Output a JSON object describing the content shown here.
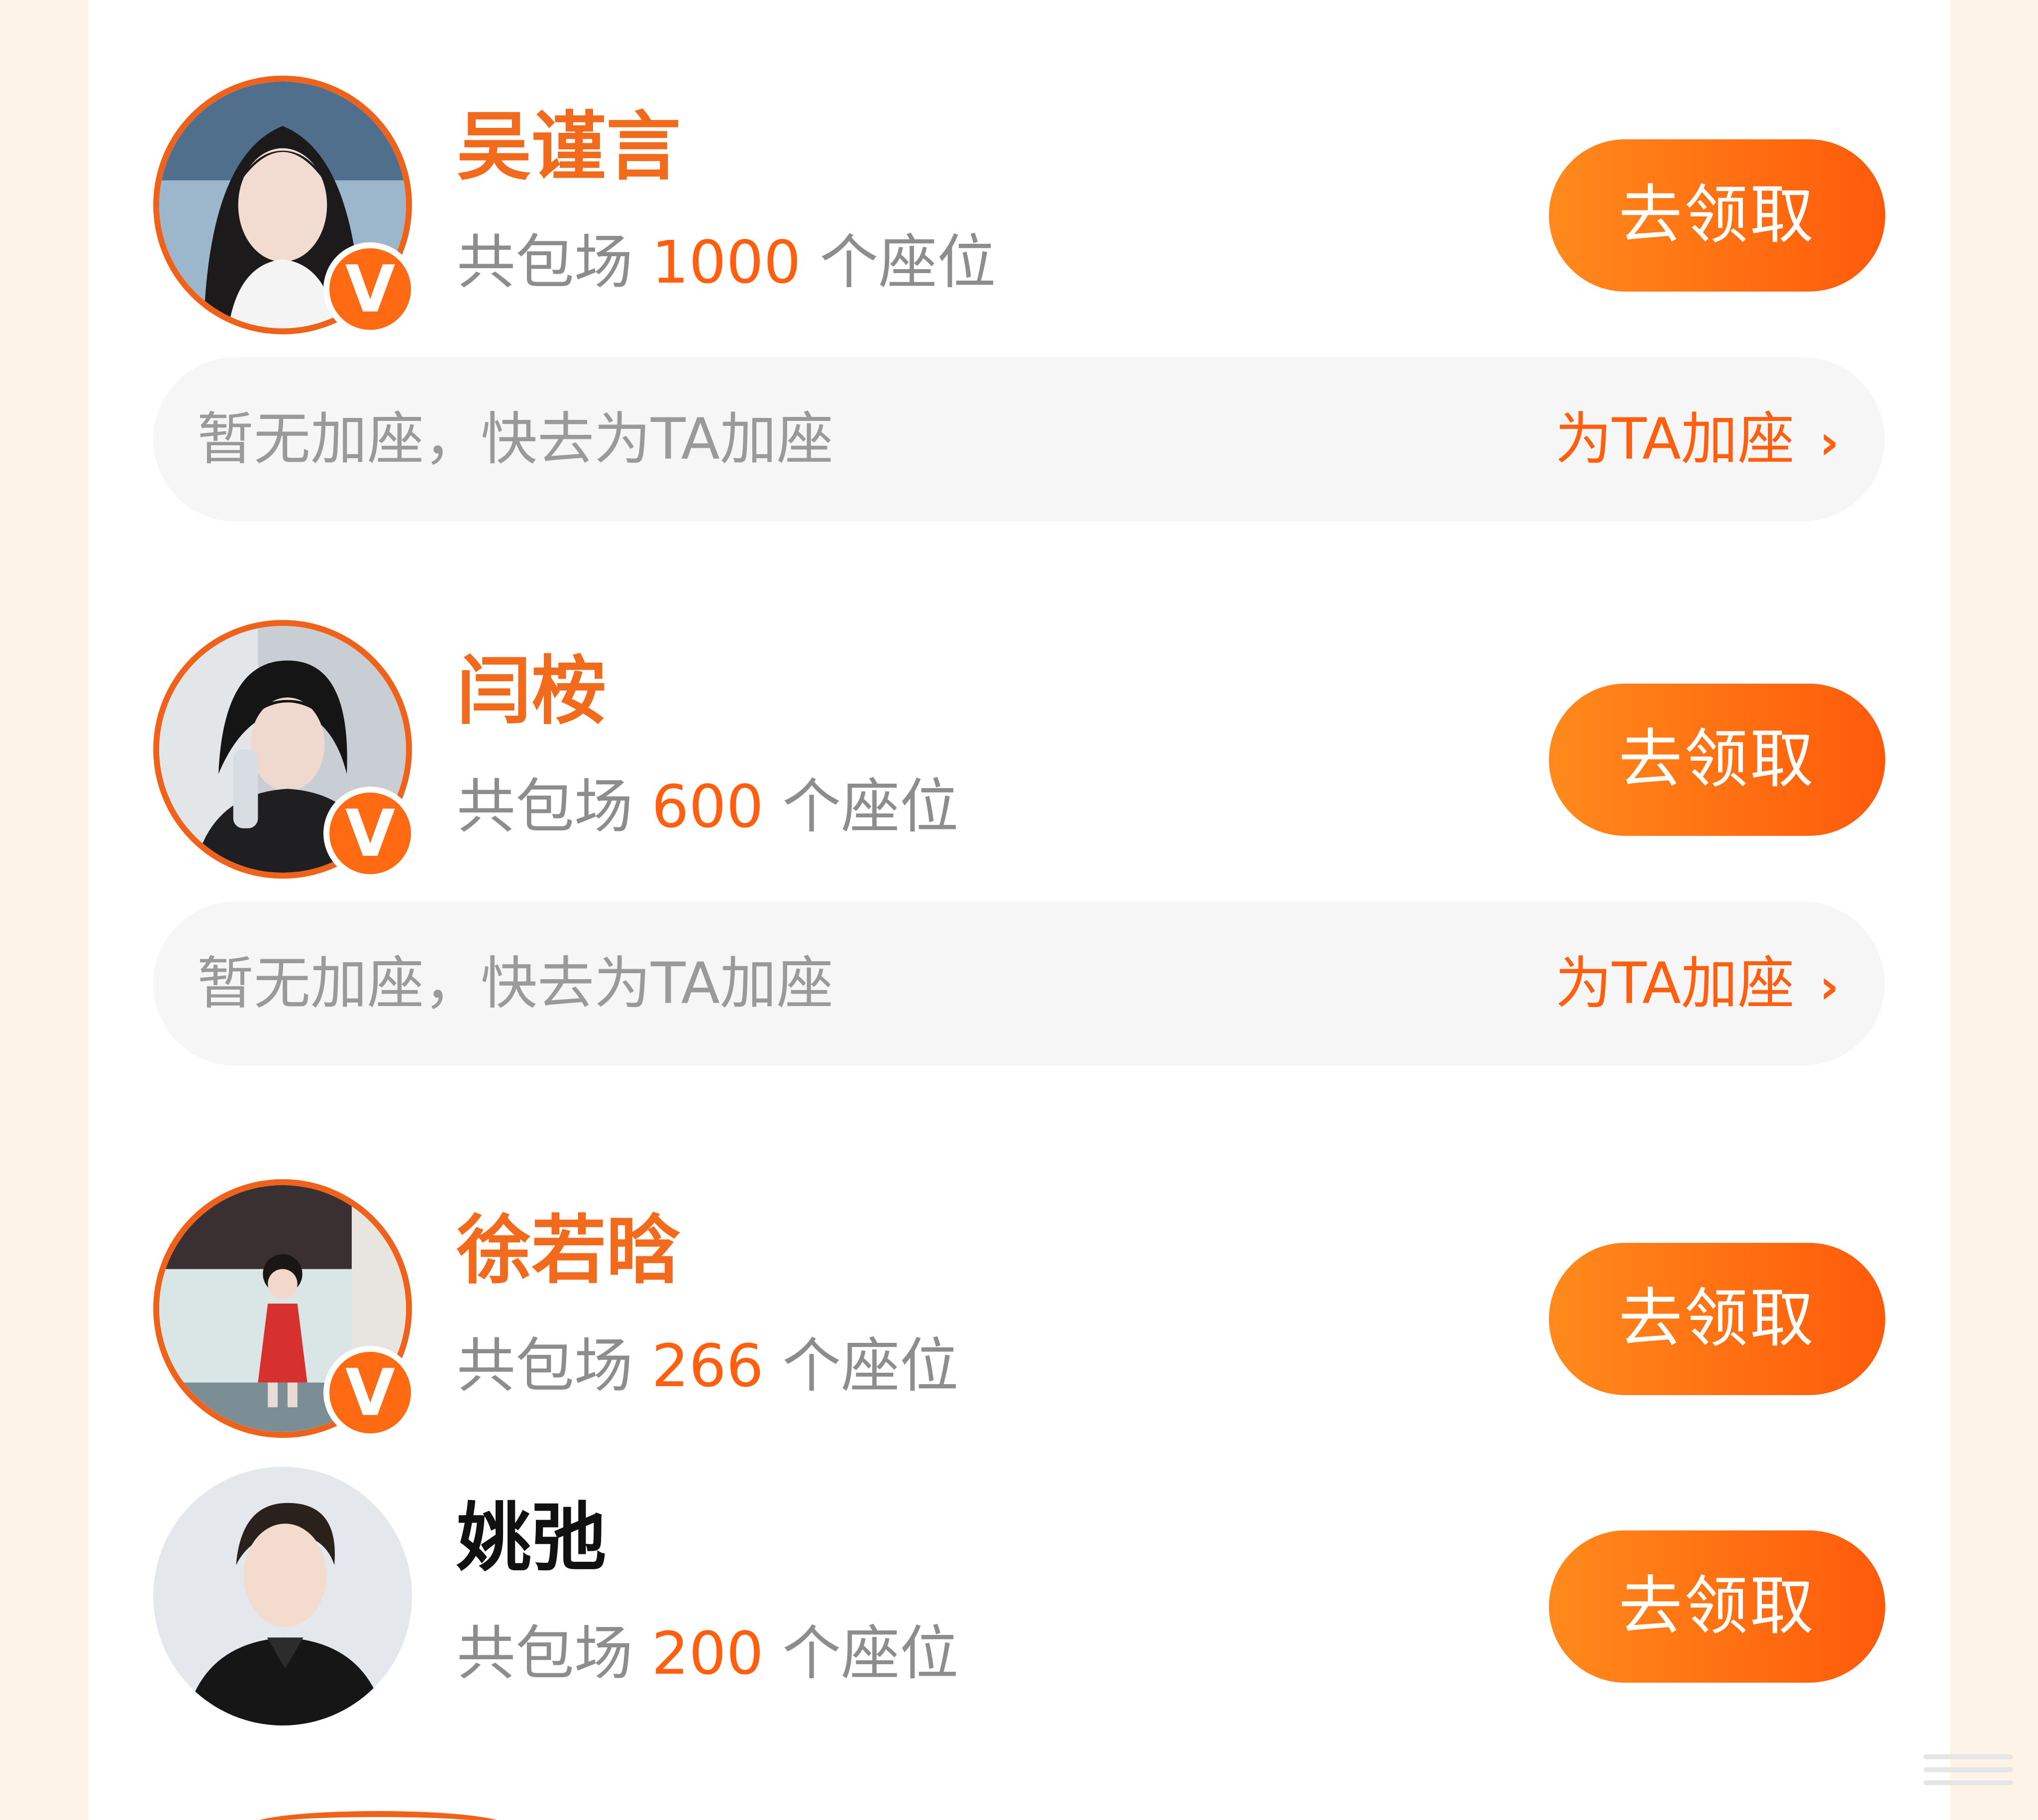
{
  "colors": {
    "accent": "#ff5f0f",
    "button_gradient_start": "#ff8a1c",
    "button_gradient_end": "#ff5a0a",
    "name_highlight": "#f26b1d",
    "name_default": "#111111",
    "muted_text": "#8d8d8d",
    "page_background": "#fdf3e7"
  },
  "entries": [
    {
      "name": "吴谨言",
      "verified_badge": "V",
      "seats_prefix": "共包场",
      "seats_count": "1000",
      "seats_suffix": "个座位",
      "claim_button": "去领取",
      "add_seat": {
        "hint": "暂无加座，快去为TA加座",
        "link": "为TA加座",
        "chevron": "›"
      }
    },
    {
      "name": "闫桉",
      "verified_badge": "V",
      "seats_prefix": "共包场",
      "seats_count": "600",
      "seats_suffix": "个座位",
      "claim_button": "去领取",
      "add_seat": {
        "hint": "暂无加座，快去为TA加座",
        "link": "为TA加座",
        "chevron": "›"
      }
    },
    {
      "name": "徐若晗",
      "verified_badge": "V",
      "seats_prefix": "共包场",
      "seats_count": "266",
      "seats_suffix": "个座位",
      "claim_button": "去领取"
    },
    {
      "name": "姚弛",
      "seats_prefix": "共包场",
      "seats_count": "200",
      "seats_suffix": "个座位",
      "claim_button": "去领取"
    }
  ]
}
